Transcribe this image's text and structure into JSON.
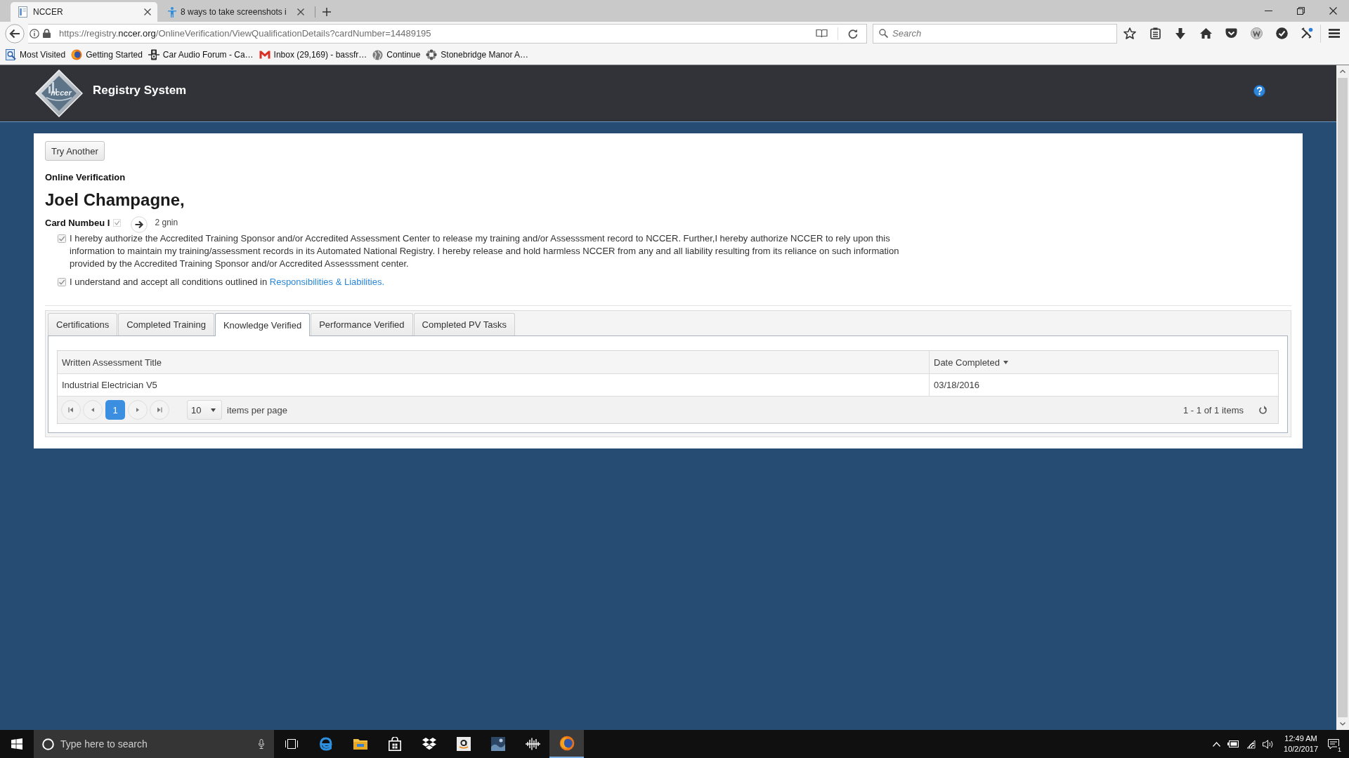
{
  "browser": {
    "tabs": [
      {
        "kind": "page",
        "title": "NCCER",
        "selected": true
      },
      {
        "kind": "figure",
        "title": "8 ways to take screenshots i",
        "selected": false
      }
    ],
    "url": {
      "start": "https://registry.",
      "domain": "nccer.org",
      "rest": "/OnlineVerification/ViewQualificationDetails?cardNumber=14489195"
    },
    "search": {
      "placeholder": "Search"
    },
    "bookmarks": [
      {
        "kind": "smart",
        "label": "Most Visited"
      },
      {
        "kind": "fox",
        "label": "Getting Started"
      },
      {
        "kind": "speaker",
        "label": "Car Audio Forum - Ca…"
      },
      {
        "kind": "mail",
        "label": "Inbox (29,169) - bassfr…"
      },
      {
        "kind": "globe",
        "label": "Continue"
      },
      {
        "kind": "flower",
        "label": "Stonebridge Manor A…"
      }
    ]
  },
  "header": {
    "logo_text": "nccer",
    "title": "Registry System"
  },
  "card": {
    "button": "Try Another",
    "heading": "Online Verification",
    "name": "Joel Champagne,",
    "card_label": "Card Numbeu I",
    "overlay_text": "2 gnin",
    "consents": [
      {
        "checked": true,
        "text": "I hereby authorize the Accredited Training Sponsor and/or Accredited Assessment Center to release my training and/or Assesssment record to NCCER. Further,I hereby authorize NCCER to rely upon this information to maintain my training/assessment records in its Automated National Registry. I hereby release and hold harmless NCCER from any and all liability resulting from its reliance on such information provided by the Accredited Training Sponsor and/or Accredited Assesssment center."
      },
      {
        "checked": true,
        "text": "I understand and accept all conditions outlined in",
        "link": "Responsibilities & Liabilities."
      }
    ]
  },
  "tabs": [
    {
      "label": "Certifications",
      "selected": false
    },
    {
      "label": "Completed Training",
      "selected": false
    },
    {
      "label": "Knowledge Verified",
      "selected": true
    },
    {
      "label": "Performance Verified",
      "selected": false
    },
    {
      "label": "Completed PV Tasks",
      "selected": false
    }
  ],
  "grid": {
    "columns": [
      {
        "label": "Written Assessment Title",
        "sorted": false
      },
      {
        "label": "Date Completed",
        "sorted": true
      }
    ],
    "rows": [
      [
        "Industrial Electrician V5",
        "03/18/2016"
      ]
    ],
    "pager": {
      "pages": [
        {
          "label": "1",
          "selected": true
        }
      ],
      "page_size": "10",
      "page_size_label": "items per page",
      "summary": "1 - 1 of 1 items"
    }
  },
  "taskbar": {
    "search": {
      "placeholder": "Type here to search"
    },
    "apps": [
      {
        "kind": "taskview",
        "selected": false
      },
      {
        "kind": "edge",
        "selected": false
      },
      {
        "kind": "folder",
        "selected": false
      },
      {
        "kind": "bag",
        "selected": false
      },
      {
        "kind": "boxes",
        "selected": false
      },
      {
        "kind": "tile",
        "selected": false
      },
      {
        "kind": "picture",
        "selected": false
      },
      {
        "kind": "wave",
        "selected": false
      },
      {
        "kind": "fox",
        "selected": true
      }
    ],
    "time": "12:49 AM",
    "date": "10/2/2017",
    "notifications": "1"
  }
}
